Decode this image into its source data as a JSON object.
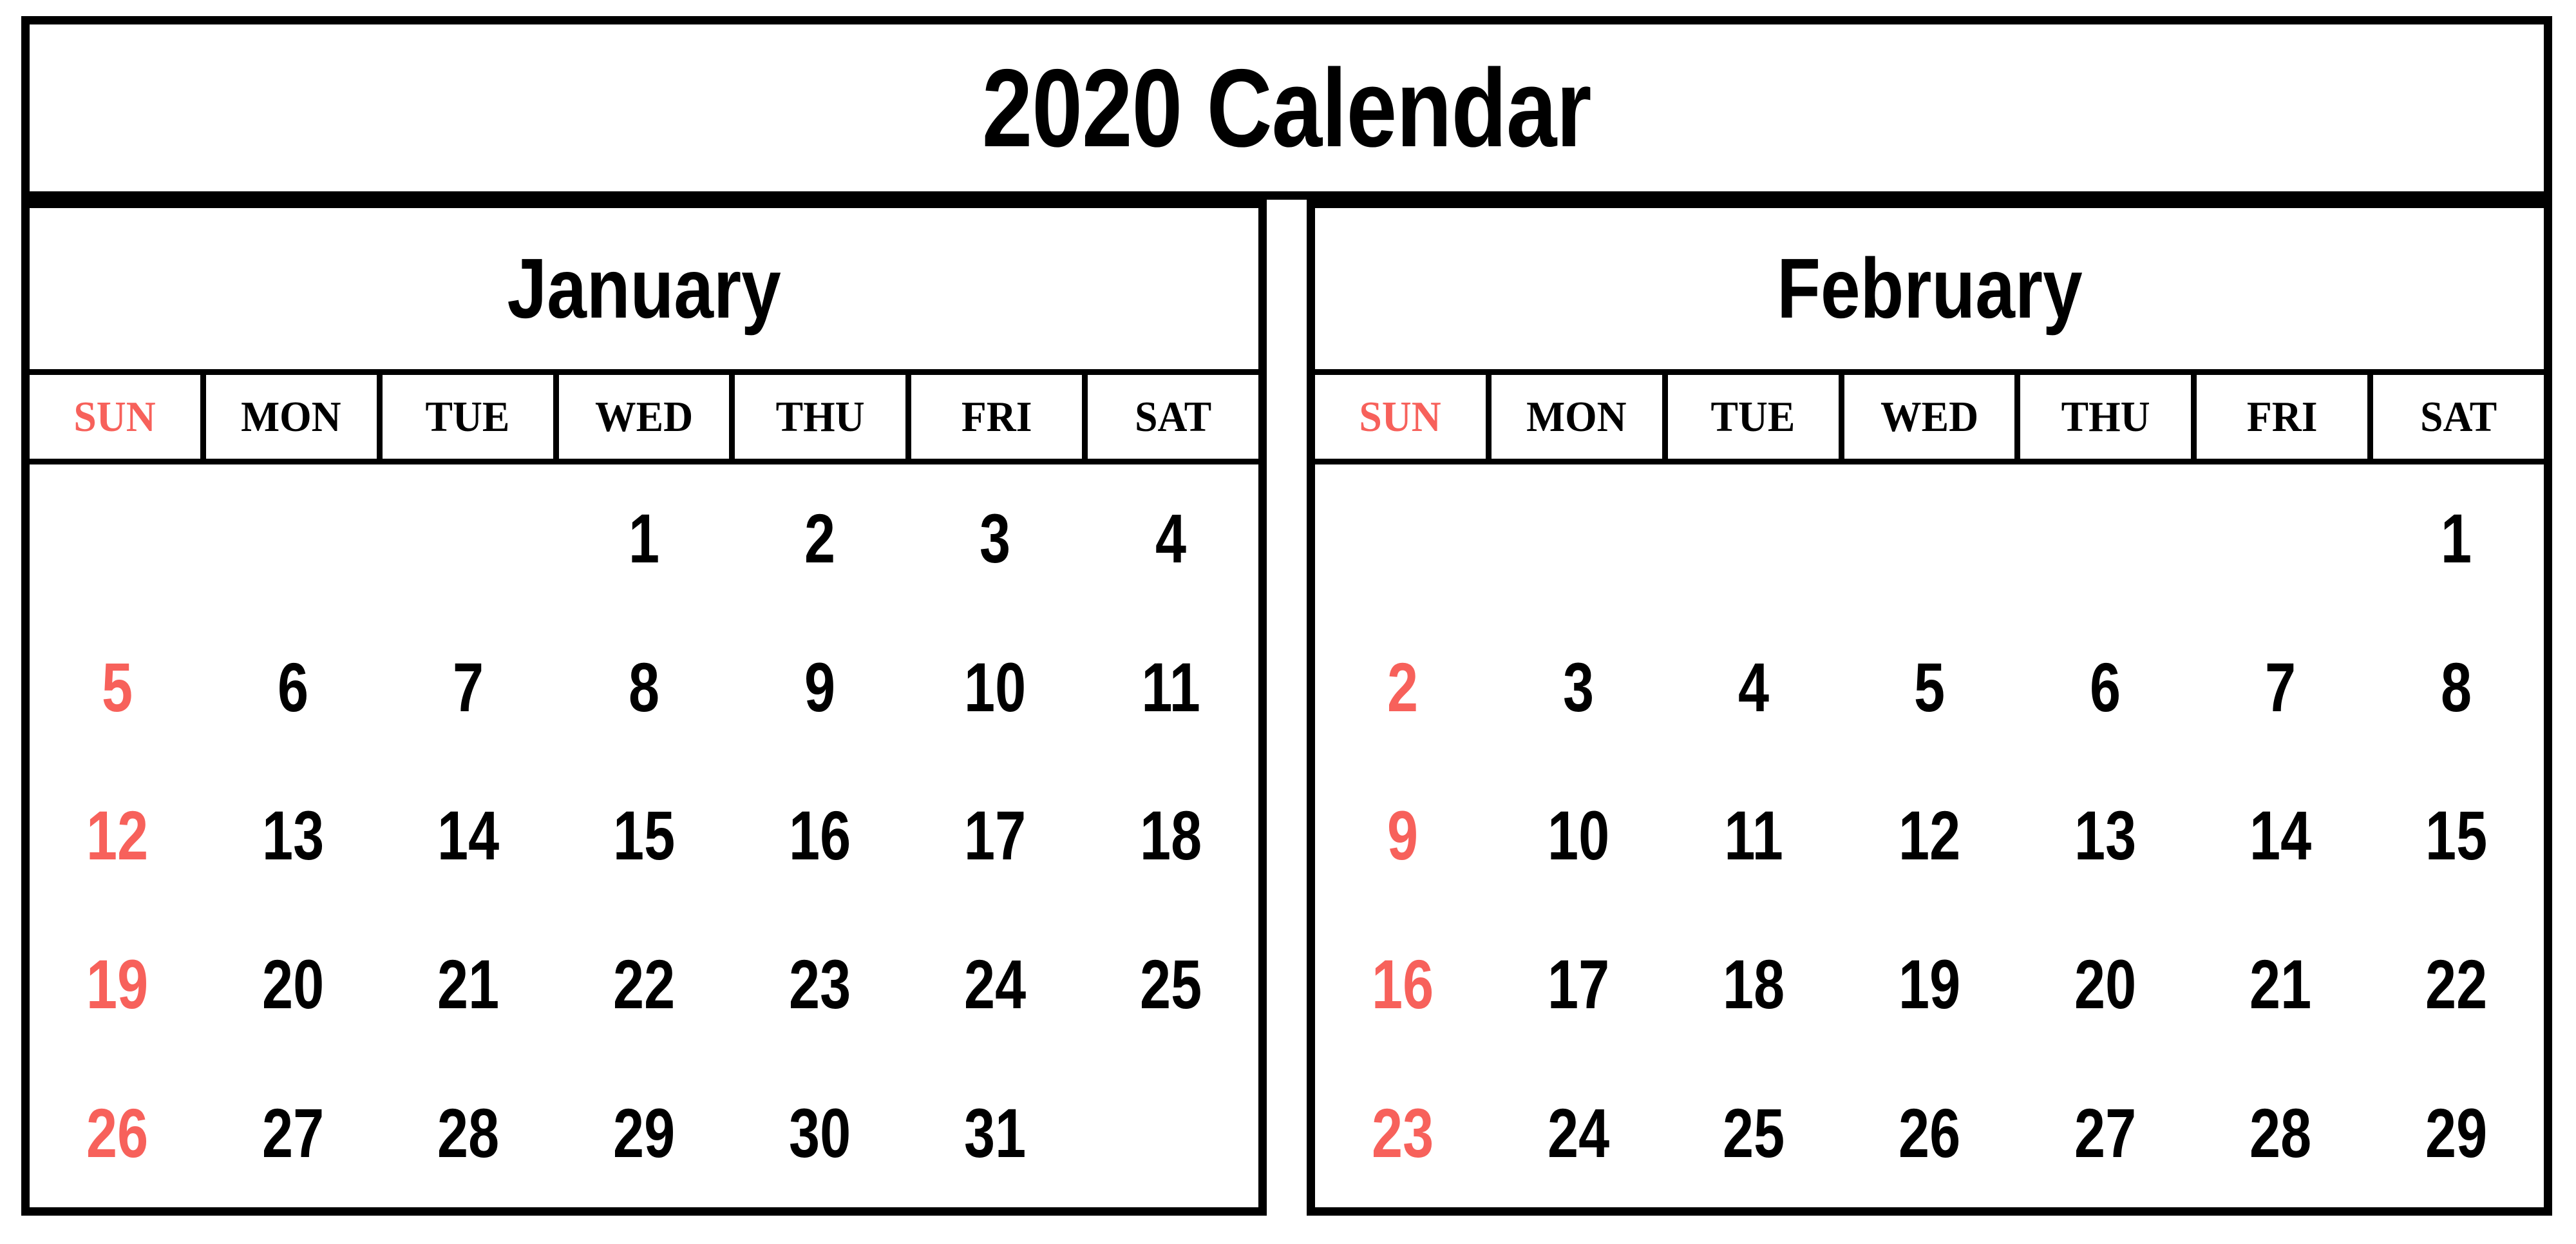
{
  "page": {
    "title": "2020 Calendar",
    "background_color": "#FFFFFF",
    "border_color": "#000000",
    "sunday_color": "#F7615B",
    "text_color": "#000000"
  },
  "weekdays": [
    "SUN",
    "MON",
    "TUE",
    "WED",
    "THU",
    "FRI",
    "SAT"
  ],
  "months": [
    {
      "name": "January",
      "weeks": [
        [
          "",
          "",
          "",
          "1",
          "2",
          "3",
          "4"
        ],
        [
          "5",
          "6",
          "7",
          "8",
          "9",
          "10",
          "11"
        ],
        [
          "12",
          "13",
          "14",
          "15",
          "16",
          "17",
          "18"
        ],
        [
          "19",
          "20",
          "21",
          "22",
          "23",
          "24",
          "25"
        ],
        [
          "26",
          "27",
          "28",
          "29",
          "30",
          "31",
          ""
        ]
      ]
    },
    {
      "name": "February",
      "weeks": [
        [
          "",
          "",
          "",
          "",
          "",
          "",
          "1"
        ],
        [
          "2",
          "3",
          "4",
          "5",
          "6",
          "7",
          "8"
        ],
        [
          "9",
          "10",
          "11",
          "12",
          "13",
          "14",
          "15"
        ],
        [
          "16",
          "17",
          "18",
          "19",
          "20",
          "21",
          "22"
        ],
        [
          "23",
          "24",
          "25",
          "26",
          "27",
          "28",
          "29"
        ]
      ]
    }
  ]
}
